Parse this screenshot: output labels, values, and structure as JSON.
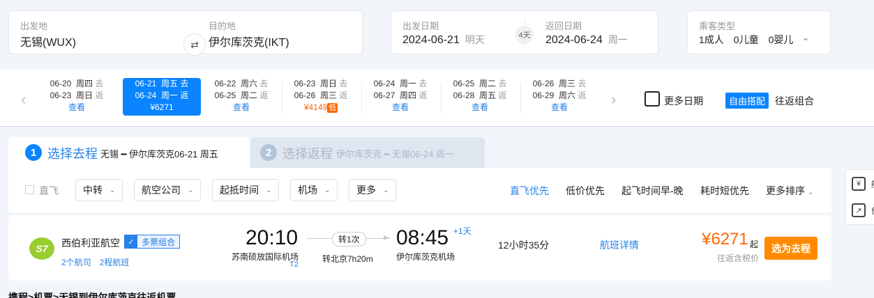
{
  "search": {
    "origin_label": "出发地",
    "origin_value": "无锡(WUX)",
    "destination_label": "目的地",
    "destination_value": "伊尔库茨克(IKT)",
    "depart_label": "出发日期",
    "depart_date": "2024-06-21",
    "depart_weekday": "明天",
    "days_badge": "4天",
    "return_label": "返回日期",
    "return_date": "2024-06-24",
    "return_weekday": "周一",
    "passenger_label": "乘客类型",
    "passenger_value": "1成人　0儿童　0婴儿"
  },
  "date_strip": [
    {
      "d1": "06-20",
      "w1": "周四",
      "t1": "去",
      "d2": "06-23",
      "w2": "周日",
      "t2": "返",
      "price": "查看",
      "low": ""
    },
    {
      "d1": "06-21",
      "w1": "周五",
      "t1": "去",
      "d2": "06-24",
      "w2": "周一",
      "t2": "返",
      "price": "¥6271",
      "low": ""
    },
    {
      "d1": "06-22",
      "w1": "周六",
      "t1": "去",
      "d2": "06-25",
      "w2": "周二",
      "t2": "返",
      "price": "查看",
      "low": ""
    },
    {
      "d1": "06-23",
      "w1": "周日",
      "t1": "去",
      "d2": "06-26",
      "w2": "周三",
      "t2": "返",
      "price": "¥4149",
      "low": "低"
    },
    {
      "d1": "06-24",
      "w1": "周一",
      "t1": "去",
      "d2": "06-27",
      "w2": "周四",
      "t2": "返",
      "price": "查看",
      "low": ""
    },
    {
      "d1": "06-25",
      "w1": "周二",
      "t1": "去",
      "d2": "06-28",
      "w2": "周五",
      "t2": "返",
      "price": "查看",
      "low": ""
    },
    {
      "d1": "06-26",
      "w1": "周三",
      "t1": "去",
      "d2": "06-29",
      "w2": "周六",
      "t2": "返",
      "price": "查看",
      "low": ""
    }
  ],
  "more_dates": "更多日期",
  "free_combo": {
    "tag": "自由搭配",
    "label": "往返组合"
  },
  "tabs": {
    "outbound": {
      "num": "1",
      "title": "选择去程",
      "route": "无锡 ━ 伊尔库茨克06-21 周五"
    },
    "return": {
      "num": "2",
      "title": "选择返程",
      "route": "伊尔库茨克 ━ 无锡06-24 周一"
    }
  },
  "filters": {
    "direct": "直飞",
    "selects": [
      "中转",
      "航空公司",
      "起抵时间",
      "机场",
      "更多"
    ],
    "sorts": [
      "直飞优先",
      "低价优先",
      "起飞时间早-晚",
      "耗时短优先",
      "更多排序"
    ]
  },
  "flight": {
    "logo": "S7",
    "airline": "西伯利亚航空",
    "badge": "多票组合",
    "legs": "2个航司　2程航班",
    "dep_time": "20:10",
    "dep_airport": "苏南硕放国际机场",
    "dep_terminal": "T2",
    "transfer": "转1次",
    "via": "转北京7h20m",
    "arr_time": "08:45",
    "arr_plus": "+1天",
    "arr_airport": "伊尔库茨克机场",
    "duration": "12小时35分",
    "detail": "航班详情",
    "price": "¥6271",
    "price_suffix": "起",
    "tax_note": "往返含税价",
    "select_button": "选为去程"
  },
  "sidebar": {
    "item1": "航",
    "item2": "价"
  },
  "breadcrumb": "携程>机票>无锡到伊尔库茨克往返机票",
  "colors": {
    "primary": "#0a84ff",
    "link": "#2681e8",
    "price": "#ff6600",
    "cta": "#ff8a00"
  }
}
